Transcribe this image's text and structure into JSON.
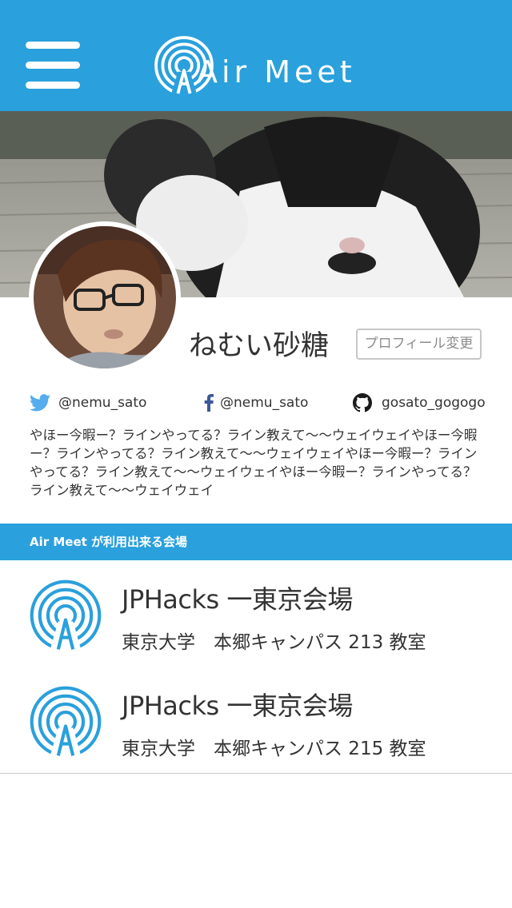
{
  "header": {
    "app_name": "Air Meet",
    "brand_color": "#2aa0dc",
    "menu_icon": "hamburger-menu-icon",
    "logo_icon": "broadcast-signal-icon"
  },
  "profile": {
    "cover_image": "cat-photo",
    "avatar_image": "user-portrait-photo",
    "name": "ねむい砂糖",
    "edit_button_label": "プロフィール変更",
    "social": [
      {
        "icon": "twitter-icon",
        "handle": "@nemu_sato"
      },
      {
        "icon": "facebook-icon",
        "handle": "@nemu_sato"
      },
      {
        "icon": "github-icon",
        "handle": "gosato_gogogo"
      }
    ],
    "bio": "やほー今暇ー？ラインやってる？ライン教えて〜〜ウェイウェイやほー今暇ー？ラインやってる？ライン教えて〜〜ウェイウェイやほー今暇ー？ラインやってる？ライン教えて〜〜ウェイウェイやほー今暇ー？ラインやってる？ライン教えて〜〜ウェイウェイ"
  },
  "venues_section": {
    "title": "Air Meet が利用出来る会場",
    "items": [
      {
        "icon": "broadcast-signal-icon",
        "name": "JPHacks 一東京会場",
        "location": "東京大学　本郷キャンパス 213 教室"
      },
      {
        "icon": "broadcast-signal-icon",
        "name": "JPHacks 一東京会場",
        "location": "東京大学　本郷キャンパス 215 教室"
      }
    ]
  }
}
